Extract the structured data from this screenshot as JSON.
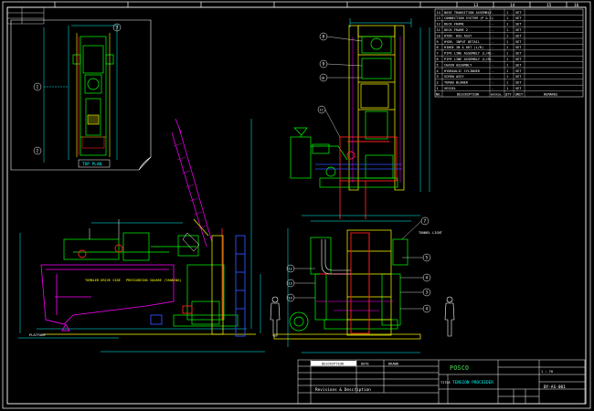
{
  "colors": {
    "background": "#000000",
    "frame": "#ffffff",
    "equipment": "#00ff00",
    "structure": "#ffff00",
    "dimension": "#00ffff",
    "pipe_magenta": "#ff00ff",
    "red": "#ff2020",
    "blue": "#3050ff",
    "logo_green": "#3ba03b"
  },
  "column_numbers": [
    "13",
    "14",
    "15",
    "16"
  ],
  "top_view": {
    "label": "TOP PLAN",
    "callouts": [
      "1",
      "2",
      "3"
    ]
  },
  "mid_view": {
    "callouts": [
      "8",
      "9",
      "10",
      "11"
    ]
  },
  "right_view": {
    "callouts": [
      "7",
      "5",
      "4",
      "3",
      "12",
      "13",
      "14"
    ],
    "side_label": "TUNNEL LIGHT"
  },
  "left_view": {
    "label_a": "TUMBLER DRIVE SIDE",
    "label_b": "PRESSUREING SQUARE (TANKING)",
    "base_label": "PLATFORM"
  },
  "parts_list": {
    "headers": [
      "NO.",
      "DESCRIPTION",
      "MATERIAL",
      "QTY",
      "UNIT",
      "REMARKS"
    ],
    "rows": [
      [
        "14",
        "BASE TRANSITION ASSEMBLY",
        "-",
        "1",
        "SET",
        ""
      ],
      [
        "13",
        "CONNECTION SYSTEM (P & C)",
        "-",
        "1",
        "SET",
        ""
      ],
      [
        "12",
        "DECK FRAME",
        "-",
        "1",
        "SET",
        ""
      ],
      [
        "11",
        "DECK FRAME 2",
        "-",
        "1",
        "SET",
        ""
      ],
      [
        "10",
        "HYDR. HSG ASSY",
        "-",
        "1",
        "SET",
        ""
      ],
      [
        "9",
        "HYDR. INPUT DETAIL",
        "-",
        "1",
        "SET",
        ""
      ],
      [
        "8",
        "HINGE IN & OUT (L/R)",
        "-",
        "1",
        "SET",
        ""
      ],
      [
        "7",
        "PIPE LINE ASSEMBLY (L/R)",
        "-",
        "1",
        "SET",
        ""
      ],
      [
        "6",
        "PIPE LINE ASSEMBLY (L/R)",
        "-",
        "1",
        "SET",
        ""
      ],
      [
        "5",
        "CHAIN ASSEMBLY",
        "-",
        "1",
        "SET",
        ""
      ],
      [
        "4",
        "HYDRAULIC CYLINDER",
        "-",
        "1",
        "SET",
        ""
      ],
      [
        "3",
        "SCREW ASSY",
        "-",
        "1",
        "SET",
        ""
      ],
      [
        "2",
        "TURBO BLOWER",
        "-",
        "1",
        "SET",
        ""
      ],
      [
        "1",
        "VESSEL",
        "-",
        "1",
        "SET",
        ""
      ]
    ]
  },
  "title_block": {
    "desc_header": "DESCRIPTION",
    "date_header": "DATE",
    "drawn_header": "DRAWN",
    "logo_text": "POSCO",
    "title_label": "TITLE",
    "project": "TENSION PROCEEDER",
    "doc_no": "BY-AS-001",
    "scale": "1 : 70",
    "revision_label": "Revisions & Description"
  }
}
